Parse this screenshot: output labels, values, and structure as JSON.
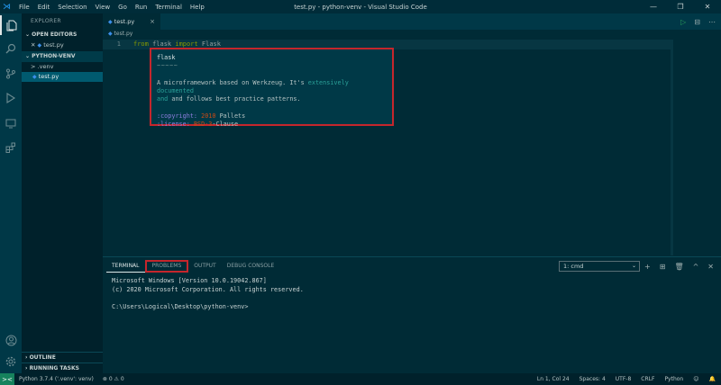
{
  "window": {
    "title": "test.py - python-venv - Visual Studio Code",
    "menu": [
      "File",
      "Edit",
      "Selection",
      "View",
      "Go",
      "Run",
      "Terminal",
      "Help"
    ],
    "controls": [
      "—",
      "❐",
      "✕"
    ]
  },
  "activity": {
    "icons": [
      "explorer-icon",
      "search-icon",
      "source-control-icon",
      "run-debug-icon",
      "remote-explorer-icon",
      "extensions-icon",
      "account-icon",
      "settings-gear-icon"
    ]
  },
  "sidebar": {
    "title": "EXPLORER",
    "open_editors": {
      "header": "OPEN EDITORS",
      "items": [
        {
          "close": "✕",
          "icon": "py",
          "label": "test.py"
        }
      ]
    },
    "folder": {
      "header": "PYTHON-VENV",
      "items": [
        {
          "chevron": ">",
          "label": ".venv"
        },
        {
          "icon": "py",
          "label": "test.py"
        }
      ]
    },
    "outline": "OUTLINE",
    "running_tasks": "RUNNING TASKS"
  },
  "editor": {
    "tab": {
      "icon": "py",
      "label": "test.py",
      "close": "×"
    },
    "actions": [
      "▷",
      "⊟",
      "⋯"
    ],
    "breadcrumb": "test.py",
    "line_number": "1",
    "code": {
      "kw1": "from",
      "mod": "flask",
      "kw2": "import",
      "cls": "Flask"
    }
  },
  "hover": {
    "title": "flask",
    "underline": "~~~~~",
    "desc_1a": "A microframework based on Werkzeug.  It's ",
    "desc_1b": "extensively documented",
    "desc_2a": "and follows best practice patterns.",
    "copyright_label": ":copyright:",
    "copyright_year": "2010",
    "copyright_value": "Pallets",
    "license_label": ":license:",
    "license_bsd": "BSD-3",
    "license_rest": "-Clause"
  },
  "panel": {
    "tabs": [
      "TERMINAL",
      "PROBLEMS",
      "OUTPUT",
      "DEBUG CONSOLE"
    ],
    "terminal_select": "1: cmd",
    "actions": [
      "+",
      "⊞",
      "🗑",
      "^",
      "✕"
    ],
    "terminal_lines": [
      "Microsoft Windows [Version 10.0.19042.867]",
      "(c) 2020 Microsoft Corporation. All rights reserved.",
      "",
      "C:\\Users\\Logical\\Desktop\\python-venv>"
    ]
  },
  "statusbar": {
    "remote": "><",
    "python": "Python 3.7.4 ('.venv': venv)",
    "problems": "⊗ 0 ⚠ 0",
    "cursor": "Ln 1, Col 24",
    "spaces": "Spaces: 4",
    "encoding": "UTF-8",
    "eol": "CRLF",
    "language": "Python",
    "feedback": "☺",
    "bell": "🔔"
  }
}
